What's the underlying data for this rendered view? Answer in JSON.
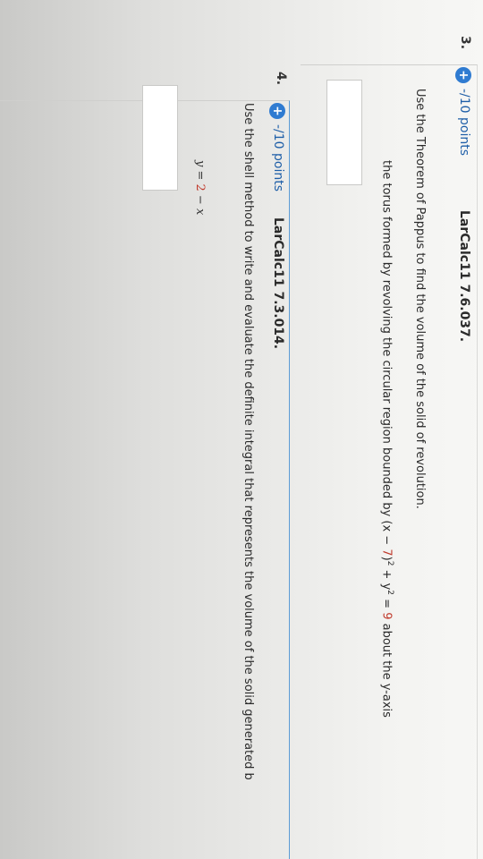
{
  "questions": [
    {
      "number": "3.",
      "points": "-/10 points",
      "reference": "LarCalc11 7.6.037.",
      "prompt_line1": "Use the Theorem of Pappus to find the volume of the solid of revolution.",
      "prompt_line2_start": "the torus formed by revolving the circular region bounded by (x − ",
      "prompt_num1": "7",
      "prompt_mid": ")",
      "prompt_sup1": "2",
      "prompt_mid2": " + y",
      "prompt_sup2": "2",
      "prompt_mid3": " = ",
      "prompt_num2": "9",
      "prompt_end": " about the y-axis"
    },
    {
      "number": "4.",
      "points": "-/10 points",
      "reference": "LarCalc11 7.3.014.",
      "prompt_line1": "Use the shell method to write and evaluate the definite integral that represents the volume of the solid generated b",
      "equation_start": "y = ",
      "equation_num": "2",
      "equation_end": " − x"
    }
  ],
  "colors": {
    "plus_icon": "#2f7bd1",
    "points_text": "#1f5fa8",
    "highlight_number": "#c0392b",
    "active_border": "#5b9bd5"
  }
}
